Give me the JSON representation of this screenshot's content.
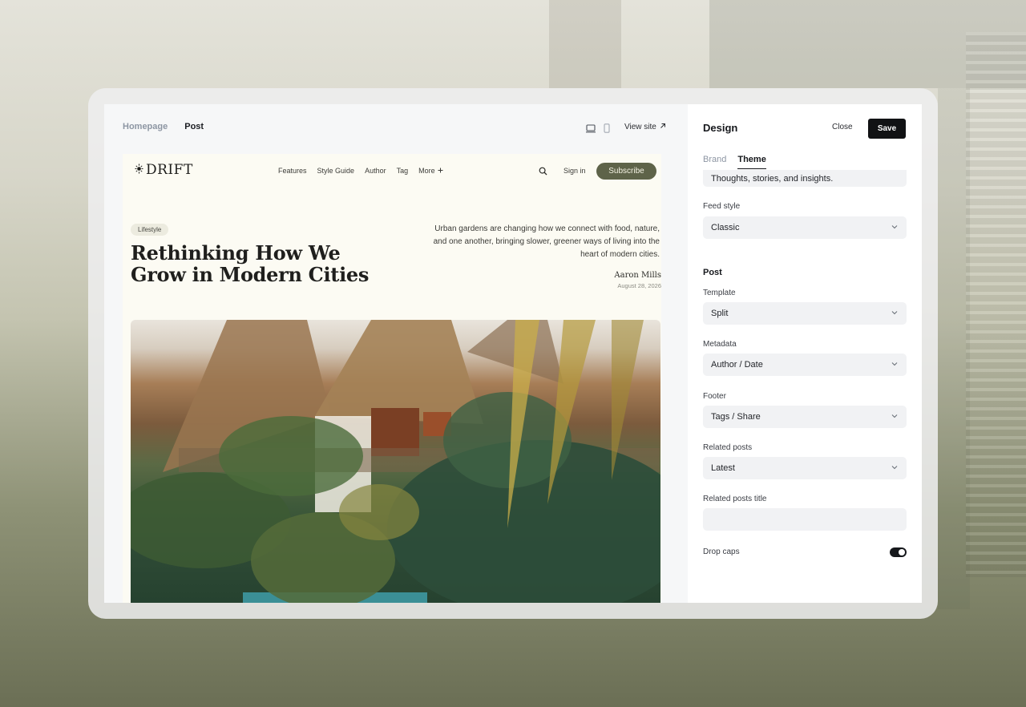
{
  "top_tabs": {
    "homepage": "Homepage",
    "post": "Post"
  },
  "toolbar": {
    "view_site": "View site",
    "view_site_icon": "arrow-up-right-icon"
  },
  "site": {
    "logo_text": "DRIFT",
    "nav": {
      "features": "Features",
      "style_guide": "Style Guide",
      "author": "Author",
      "tag": "Tag",
      "more": "More"
    },
    "sign_in": "Sign in",
    "subscribe": "Subscribe",
    "category": "Lifestyle",
    "title": "Rethinking How We Grow in Modern Cities",
    "excerpt": "Urban gardens are changing how we connect with food, nature, and one another, bringing slower, greener ways of living into the heart of modern cities.",
    "author": "Aaron Mills",
    "date": "August 28, 2026"
  },
  "panel": {
    "title": "Design",
    "close": "Close",
    "save": "Save",
    "tabs": {
      "brand": "Brand",
      "theme": "Theme"
    },
    "description_value": "Thoughts, stories, and insights.",
    "feed_style": {
      "label": "Feed style",
      "value": "Classic"
    },
    "post_section": "Post",
    "template": {
      "label": "Template",
      "value": "Split"
    },
    "metadata": {
      "label": "Metadata",
      "value": "Author / Date"
    },
    "footer": {
      "label": "Footer",
      "value": "Tags / Share"
    },
    "related_posts": {
      "label": "Related posts",
      "value": "Latest"
    },
    "related_posts_title": {
      "label": "Related posts title",
      "value": ""
    },
    "drop_caps": {
      "label": "Drop caps",
      "enabled": true
    }
  },
  "colors": {
    "subscribe_bg": "#5e6349",
    "save_bg": "#111214",
    "site_bg": "#fcfbf3"
  }
}
